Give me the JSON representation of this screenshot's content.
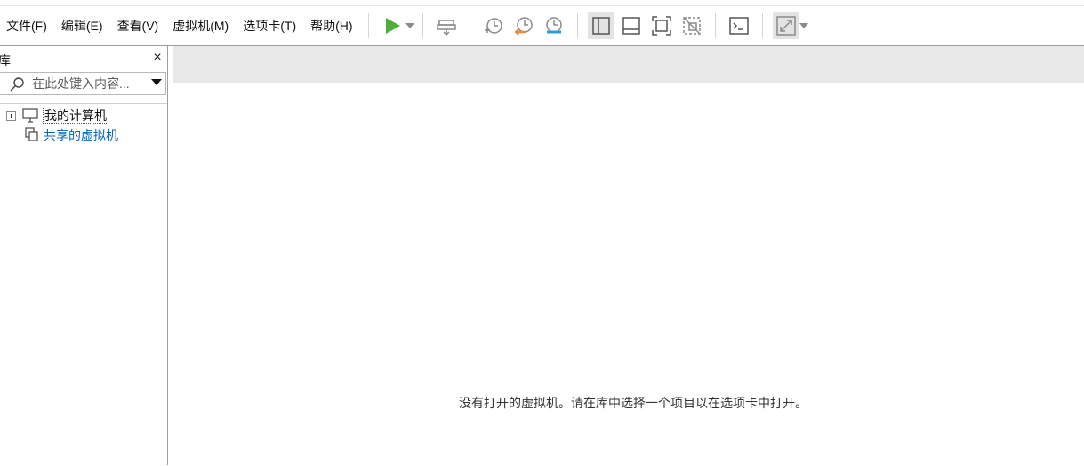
{
  "menu": [
    {
      "id": "file",
      "label": "文件(F)"
    },
    {
      "id": "edit",
      "label": "编辑(E)"
    },
    {
      "id": "view",
      "label": "查看(V)"
    },
    {
      "id": "vm",
      "label": "虚拟机(M)"
    },
    {
      "id": "tabs",
      "label": "选项卡(T)"
    },
    {
      "id": "help",
      "label": "帮助(H)"
    }
  ],
  "toolbar": {
    "icons": [
      "play-icon",
      "send-keys-icon",
      "snapshot-take-icon",
      "snapshot-revert-icon",
      "snapshot-manager-icon",
      "show-library-icon",
      "thumbnail-bar-icon",
      "full-screen-icon",
      "unity-icon",
      "console-view-icon",
      "stretch-guest-icon"
    ],
    "colors": {
      "play": "#4caf3a",
      "snapshot_revert": "#e88a3a",
      "snapshot_manager": "#2a9fd6"
    }
  },
  "library": {
    "title": "库",
    "close_symbol": "×",
    "search": {
      "placeholder": "在此处键入内容..."
    },
    "tree": [
      {
        "label": "我的计算机",
        "icon": "monitor-icon",
        "expandable": true
      },
      {
        "label": "共享的虚拟机",
        "icon": "shared-vm-icon",
        "link": true
      }
    ]
  },
  "main": {
    "empty_message": "没有打开的虚拟机。请在库中选择一个项目以在选项卡中打开。"
  }
}
